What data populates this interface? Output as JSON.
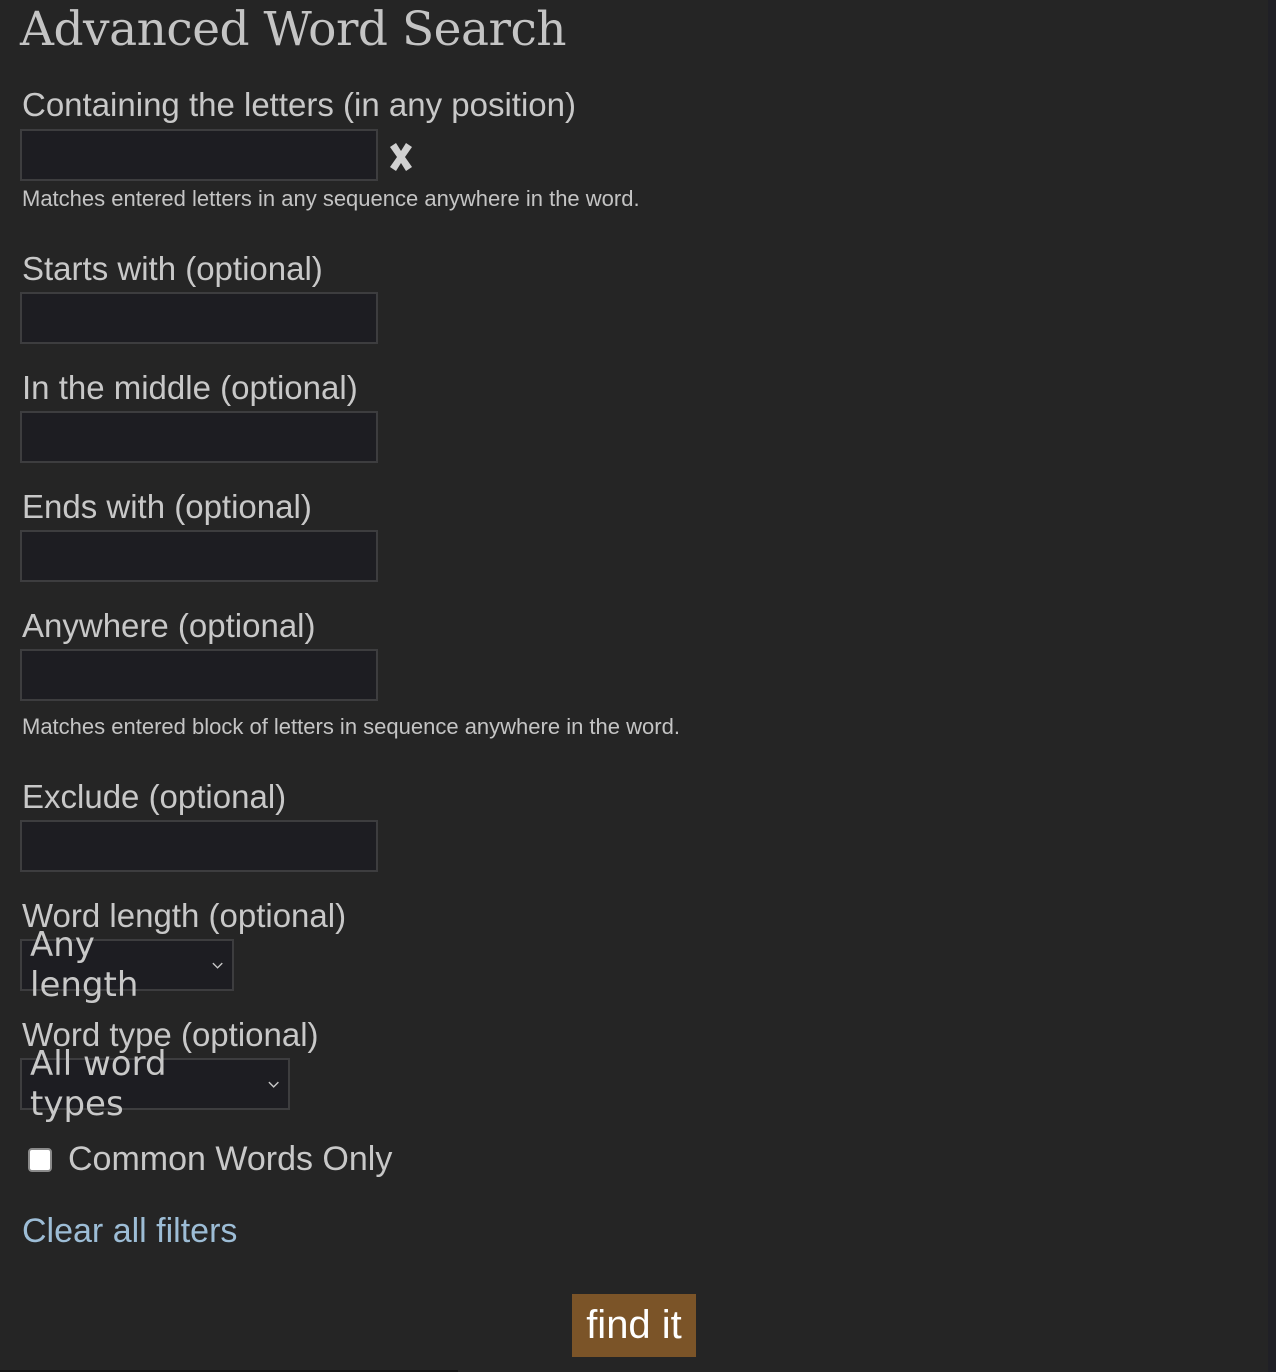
{
  "page": {
    "title": "Advanced Word Search"
  },
  "fields": {
    "containing": {
      "label": "Containing the letters (in any position)",
      "value": "",
      "placeholder": "",
      "help": "Matches entered letters in any sequence anywhere in the word.",
      "clear_icon": "heavy-multiplication-x"
    },
    "starts_with": {
      "label": "Starts with (optional)",
      "value": "",
      "placeholder": ""
    },
    "middle": {
      "label": "In the middle (optional)",
      "value": "",
      "placeholder": ""
    },
    "ends_with": {
      "label": "Ends with (optional)",
      "value": "",
      "placeholder": ""
    },
    "anywhere": {
      "label": "Anywhere (optional)",
      "value": "",
      "placeholder": "",
      "help": "Matches entered block of letters in sequence anywhere in the word."
    },
    "exclude": {
      "label": "Exclude (optional)",
      "value": "",
      "placeholder": ""
    },
    "word_length": {
      "label": "Word length (optional)",
      "selected": "Any length"
    },
    "word_type": {
      "label": "Word type (optional)",
      "selected": "All word types"
    },
    "common_only": {
      "label": "Common Words Only",
      "checked": false
    }
  },
  "actions": {
    "clear_all": "Clear all filters",
    "submit": "find it"
  },
  "colors": {
    "background": "#252525",
    "link": "#9dbdd6",
    "button": "#7b5428"
  }
}
